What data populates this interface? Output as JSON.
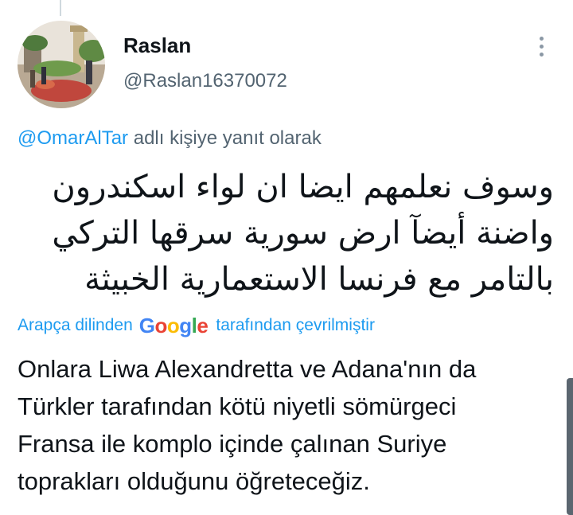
{
  "tweet": {
    "display_name": "Raslan",
    "handle": "@Raslan16370072",
    "reply_to_mention": "@OmarAlTar",
    "reply_to_suffix": " adlı kişiye yanıt olarak",
    "text_lines": [
      "وسوف نعلمهم ايضا ان لواء اسكندرون",
      "واضنة أيضآ ارض سورية سرقها التركي",
      "بالتامر مع فرنسا الاستعمارية الخبيثة"
    ],
    "translation_prefix": "Arapça dilinden",
    "translation_provider": "Google",
    "translation_suffix": "tarafından çevrilmiştir",
    "translated_lines": [
      "Onlara Liwa Alexandretta ve Adana'nın da",
      "Türkler tarafından kötü niyetli sömürgeci",
      "Fransa ile komplo içinde çalınan Suriye",
      "toprakları olduğunu öğreteceğiz."
    ]
  },
  "icons": {
    "more": "more-vertical-icon",
    "avatar": "profile-avatar"
  },
  "colors": {
    "link": "#1d9bf0",
    "secondary_text": "#536471",
    "primary_text": "#0f1419",
    "google_blue": "#4285F4",
    "google_red": "#EA4335",
    "google_yellow": "#FBBC05",
    "google_green": "#34A853"
  }
}
